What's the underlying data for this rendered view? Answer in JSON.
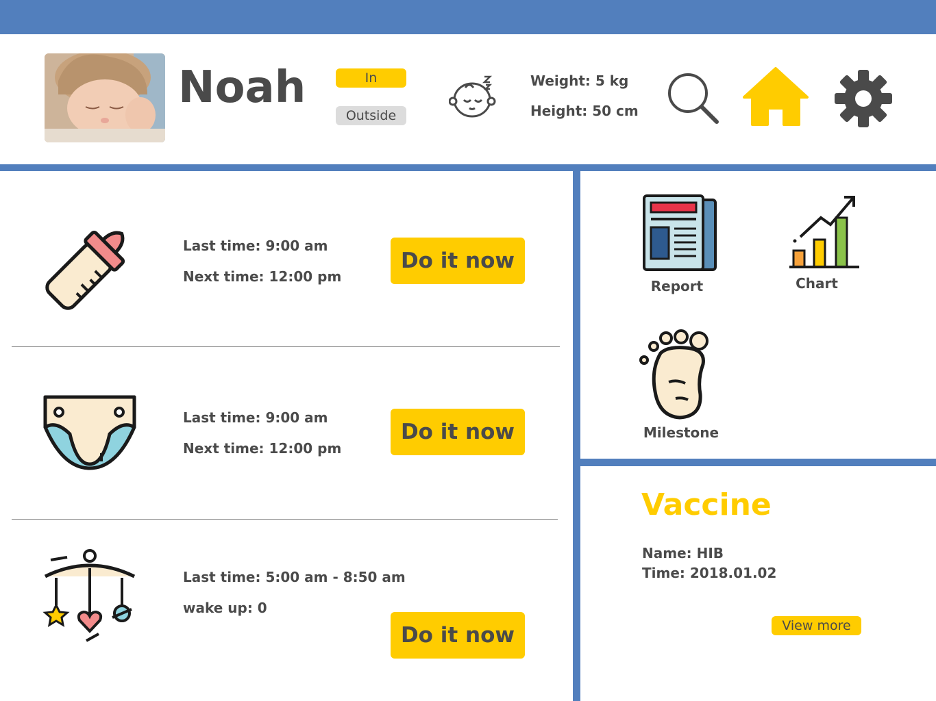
{
  "profile": {
    "name": "Noah",
    "avatar_icon": "baby-photo",
    "status_in": "In",
    "status_outside": "Outside",
    "sleep_icon": "sleeping-baby-icon",
    "weight": "Weight: 5 kg",
    "height": "Height: 50 cm"
  },
  "toolbar": {
    "search_icon": "search-icon",
    "home_icon": "home-icon",
    "settings_icon": "gear-icon"
  },
  "tasks": [
    {
      "icon": "baby-bottle-icon",
      "line1": "Last time: 9:00 am",
      "line2": "Next time: 12:00 pm",
      "button": "Do it now"
    },
    {
      "icon": "diaper-icon",
      "line1": "Last time: 9:00 am",
      "line2": "Next time: 12:00 pm",
      "button": "Do it now"
    },
    {
      "icon": "crib-mobile-icon",
      "line1": "Last time: 5:00 am - 8:50 am",
      "line2": "wake up: 0",
      "button": "Do it now"
    }
  ],
  "shortcuts": [
    {
      "icon": "newspaper-icon",
      "label": "Report"
    },
    {
      "icon": "growth-chart-icon",
      "label": "Chart"
    },
    {
      "icon": "footprint-icon",
      "label": "Milestone"
    }
  ],
  "vaccine": {
    "title": "Vaccine",
    "name": "Name: HIB",
    "time": "Time: 2018.01.02",
    "view_more": "View more"
  },
  "colors": {
    "accent_blue": "#527fbd",
    "accent_yellow": "#ffcc00",
    "text_gray": "#4a4a4a"
  }
}
